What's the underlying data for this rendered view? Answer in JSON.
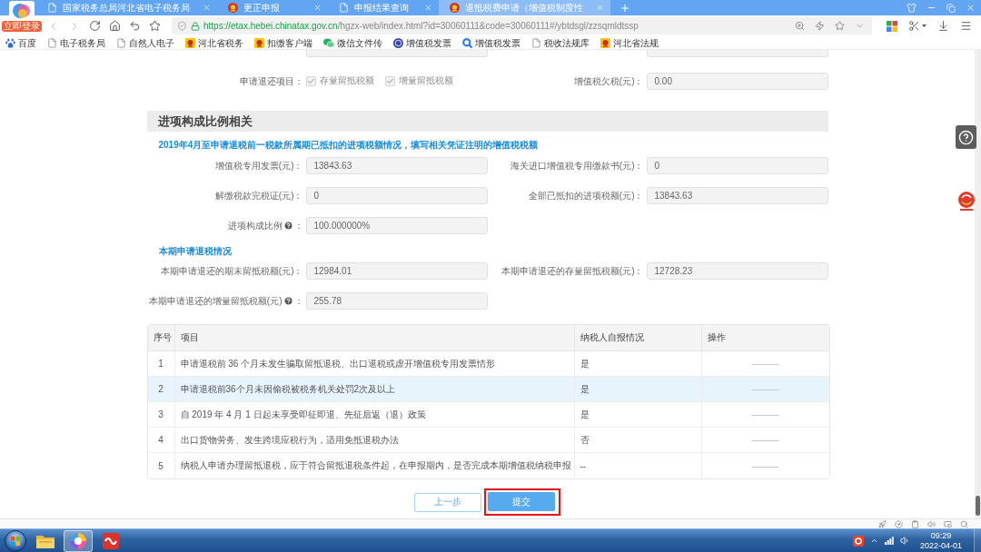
{
  "browser": {
    "account_badge": "立即登录",
    "tabs": [
      {
        "kind": "page",
        "title": "国家税务总局河北省电子税务局",
        "selected": false
      },
      {
        "kind": "emblem",
        "title": "更正申报",
        "selected": false
      },
      {
        "kind": "page",
        "title": "申报结果查询",
        "selected": false
      },
      {
        "kind": "emblem",
        "title": "退抵税费申请（增值税制度性",
        "selected": true
      }
    ],
    "address": {
      "host": "https://etax.hebei.chinatax.gov.cn",
      "path": "/hgzx-web/index.html?id=30060111&code=30060111#/ybtdsgl/zzsqmldtssp"
    },
    "bookmarks": [
      {
        "kind": "paw",
        "label": "百度"
      },
      {
        "kind": "page",
        "label": "电子税务局"
      },
      {
        "kind": "page",
        "label": "自然人电子"
      },
      {
        "kind": "emblem",
        "label": "河北省税务"
      },
      {
        "kind": "emblem",
        "label": "扣缴客户端"
      },
      {
        "kind": "chat",
        "label": "微信文件传"
      },
      {
        "kind": "round",
        "label": "增值税发票"
      },
      {
        "kind": "magnifier",
        "label": "增值税发票"
      },
      {
        "kind": "page",
        "label": "税收法规库"
      },
      {
        "kind": "emblem",
        "label": "河北省法规"
      }
    ]
  },
  "form": {
    "refund_items": {
      "label": "申请退还项目：",
      "options": [
        {
          "label": "存量留抵税额",
          "checked": true,
          "disabled": true
        },
        {
          "label": "增量留抵税额",
          "checked": true,
          "disabled": true
        }
      ]
    },
    "arrears": {
      "label": "增值税欠税(元)：",
      "value": "0.00"
    },
    "section_title": "进项构成比例相关",
    "groups": [
      {
        "title": "2019年4月至申请退税前一税款所属期已抵扣的进项税额情况，填写相关凭证注明的增值税税额",
        "fields": [
          {
            "label": "增值税专用发票(元)：",
            "help": false,
            "value": "13843.63"
          },
          {
            "label": "海关进口增值税专用缴款书(元)：",
            "help": false,
            "value": "0"
          },
          {
            "label": "解缴税款完税证(元)：",
            "help": false,
            "value": "0"
          },
          {
            "label": "全部已抵扣的进项税额(元)：",
            "help": false,
            "value": "13843.63"
          },
          {
            "label": "进项构成比例",
            "help": true,
            "colon": "：",
            "value": "100.000000%"
          }
        ]
      },
      {
        "title": "本期申请退税情况",
        "fields": [
          {
            "label": "本期申请退还的期末留抵税额(元)：",
            "help": false,
            "value": "12984.01"
          },
          {
            "label": "本期申请退还的存量留抵税额(元)：",
            "help": false,
            "value": "12728.23"
          },
          {
            "label": "本期申请退还的增量留抵税额(元)",
            "help": true,
            "colon": "：",
            "value": "255.78"
          }
        ]
      }
    ]
  },
  "table": {
    "columns": [
      "序号",
      "项目",
      "纳税人自报情况",
      "操作"
    ],
    "rows": [
      {
        "no": "1",
        "item": "申请退税前 36 个月未发生骗取留抵退税、出口退税或虚开增值税专用发票情形",
        "self_report": "是",
        "action": "———",
        "selected": false
      },
      {
        "no": "2",
        "item": "申请退税前36个月未因偷税被税务机关处罚2次及以上",
        "self_report": "是",
        "action": "———",
        "selected": true
      },
      {
        "no": "3",
        "item": "自 2019 年 4 月 1 日起未享受即征即退、先征后返（退）政策",
        "self_report": "是",
        "action": "———",
        "selected": false
      },
      {
        "no": "4",
        "item": "出口货物劳务、发生跨境应税行为，适用免抵退税办法",
        "self_report": "否",
        "action": "———",
        "selected": false
      },
      {
        "no": "5",
        "item": "纳税人申请办理留抵退税，应于符合留抵退税条件起，在申报期内，是否完成本期增值税纳税申报",
        "self_report": "--",
        "action": "———",
        "selected": false
      }
    ]
  },
  "buttons": [
    {
      "kind": "secondary",
      "label": "上一步",
      "highlighted": false
    },
    {
      "kind": "primary",
      "label": "提交",
      "highlighted": true
    }
  ],
  "taskbar": {
    "apps": [
      {
        "kind": "explorer",
        "selected": false
      },
      {
        "kind": "browser",
        "selected": true
      },
      {
        "kind": "wps",
        "selected": false
      }
    ],
    "time": "09:29",
    "date": "2022-04-01"
  }
}
